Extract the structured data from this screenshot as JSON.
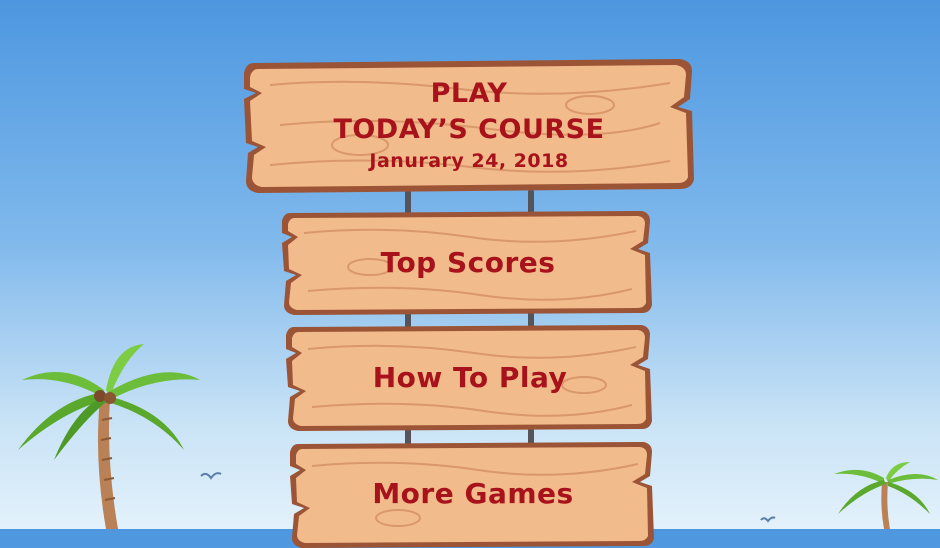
{
  "main_sign": {
    "line1": "PLAY",
    "line2": "TODAY’S COURSE",
    "date": "Janurary 24, 2018"
  },
  "menu": {
    "top_scores": "Top Scores",
    "how_to_play": "How To Play",
    "more_games": "More Games"
  },
  "colors": {
    "sky_top": "#4d97e0",
    "sky_bottom": "#e3f1fb",
    "wood": "#f2bb8c",
    "wood_edge": "#9b5536",
    "text": "#a7121b"
  },
  "icons": [
    "palm-tree-icon",
    "seagull-icon"
  ]
}
